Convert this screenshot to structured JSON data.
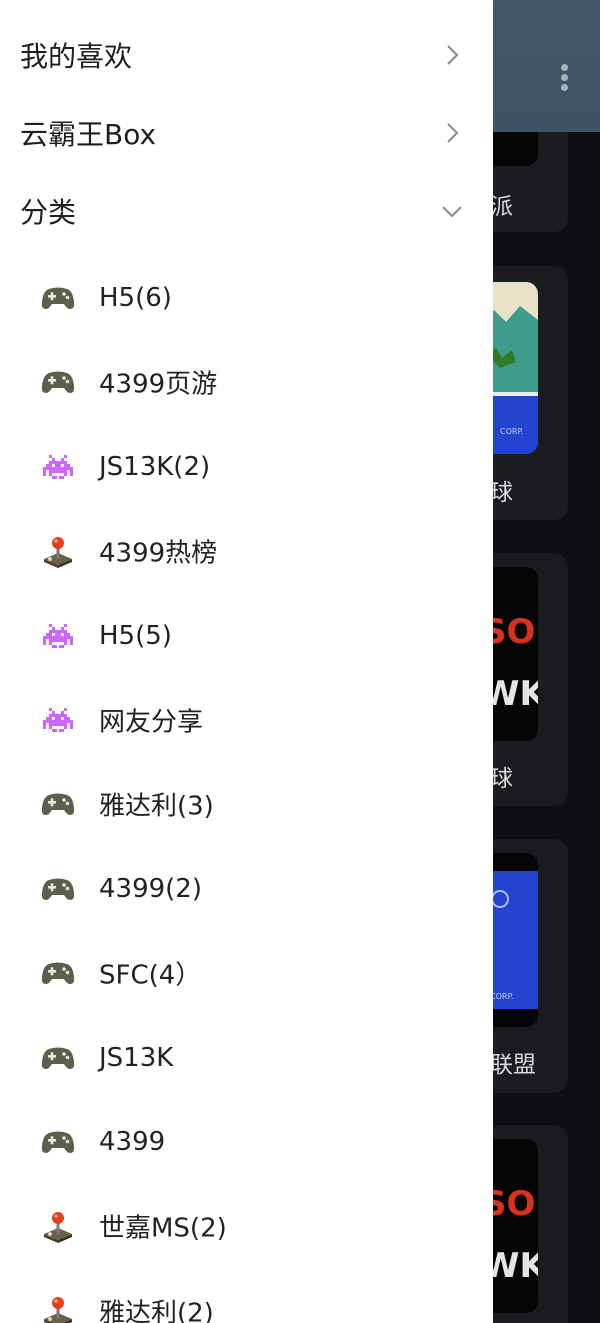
{
  "drawer": {
    "sections": [
      {
        "label": "我的喜欢",
        "state": "collapsed"
      },
      {
        "label": "云霸王Box",
        "state": "collapsed"
      },
      {
        "label": "分类",
        "state": "expanded"
      }
    ],
    "categories": [
      {
        "label": "H5(6)",
        "icon": "gamepad-icon"
      },
      {
        "label": "4399页游",
        "icon": "gamepad-icon"
      },
      {
        "label": "JS13K(2)",
        "icon": "space-invader-icon"
      },
      {
        "label": "4399热榜",
        "icon": "joystick-icon"
      },
      {
        "label": "H5(5)",
        "icon": "space-invader-icon"
      },
      {
        "label": "网友分享",
        "icon": "space-invader-icon"
      },
      {
        "label": "雅达利(3)",
        "icon": "gamepad-icon"
      },
      {
        "label": "4399(2)",
        "icon": "gamepad-icon"
      },
      {
        "label": "SFC(4）",
        "icon": "gamepad-icon"
      },
      {
        "label": "JS13K",
        "icon": "gamepad-icon"
      },
      {
        "label": "4399",
        "icon": "gamepad-icon"
      },
      {
        "label": "世嘉MS(2)",
        "icon": "joystick-icon"
      },
      {
        "label": "雅达利(2)",
        "icon": "joystick-icon"
      }
    ]
  },
  "background": {
    "menu_icon": "more-vertical-icon",
    "game_card_labels": [
      "派",
      "球",
      "球",
      "联盟"
    ],
    "thumb_texts": [
      "CORP.",
      "SON",
      "WK",
      "CORP.",
      "SON",
      "WK"
    ]
  },
  "colors": {
    "drawer_bg": "#ffffff",
    "app_bg": "#0d0f13",
    "header_bg": "#43596a",
    "chevron": "#8a8a8a",
    "invader": "#cc66ff",
    "gamepad": "#5c5f4a",
    "joystick_ball": "#e0401a"
  }
}
